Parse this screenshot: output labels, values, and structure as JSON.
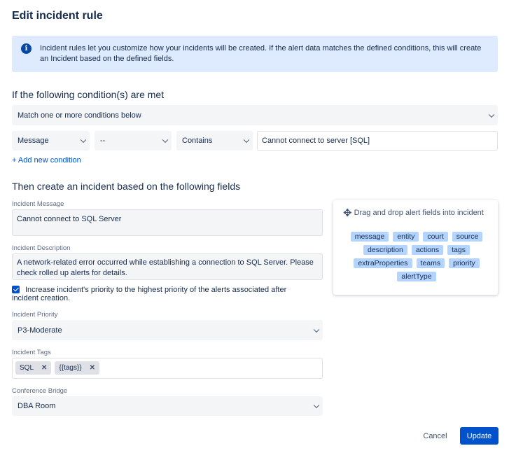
{
  "title": "Edit incident rule",
  "info": {
    "icon": "info-icon",
    "text": "Incident rules let you customize how your incidents will be created. If the alert data matches the defined conditions, this will create an Incident based on the defined fields."
  },
  "conditions": {
    "heading": "If the following condition(s) are met",
    "match": "Match one or more conditions below",
    "field": "Message",
    "operator_not": "--",
    "operator": "Contains",
    "value": "Cannot connect to server [SQL]",
    "add_link": "+ Add new condition"
  },
  "incident": {
    "heading": "Then create an incident based on the following fields",
    "message_label": "Incident Message",
    "message_value": "Cannot connect to SQL Server",
    "description_label": "Incident Description",
    "description_value": "A network-related error occurred while establishing a connection to SQL Server. Please check rolled up alerts for details.",
    "priority_checkbox": "Increase incident's priority to the highest priority of the alerts associated after incident creation.",
    "priority_label": "Incident Priority",
    "priority_value": "P3-Moderate",
    "tags_label": "Incident Tags",
    "tags": [
      "SQL",
      "{{tags}}"
    ],
    "bridge_label": "Conference Bridge",
    "bridge_value": "DBA Room"
  },
  "drag_panel": {
    "title": "Drag and drop alert fields into incident",
    "icon": "drag-hand-icon",
    "fields": [
      "message",
      "entity",
      "court",
      "source",
      "description",
      "actions",
      "tags",
      "extraProperties",
      "teams",
      "priority",
      "alertType"
    ]
  },
  "footer": {
    "cancel": "Cancel",
    "update": "Update"
  },
  "colors": {
    "primary": "#0052cc",
    "info_bg": "#deebff",
    "chip_bg": "#b3d4ff"
  }
}
